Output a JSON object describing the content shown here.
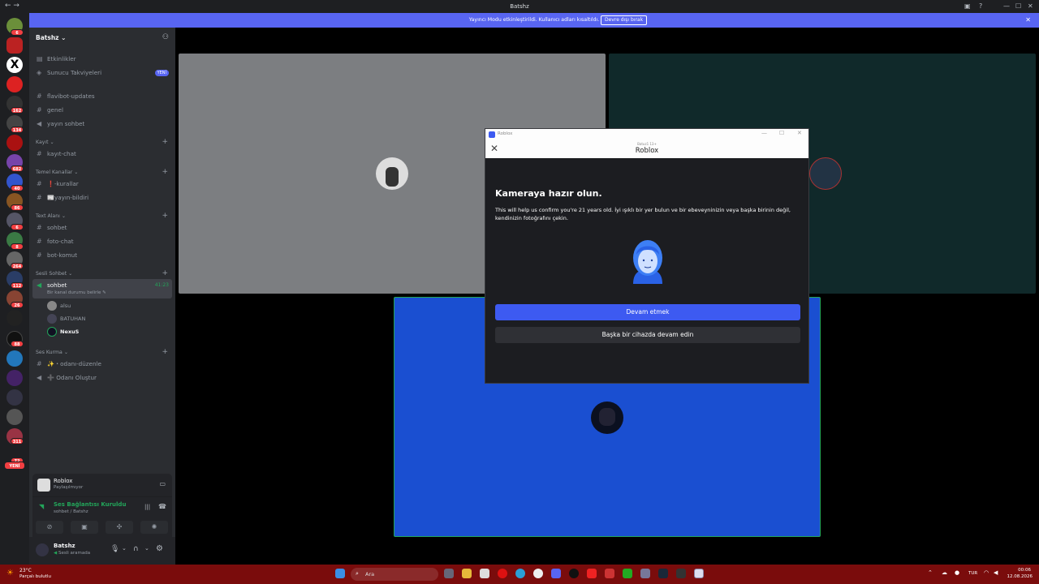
{
  "window": {
    "title": "Batshz",
    "back": "←",
    "forward": "→"
  },
  "banner": {
    "text": "Yayıncı Modu etkinleştirildi. Kullanıcı adları kısaltıldı.",
    "button": "Devre dışı bırak"
  },
  "rail": {
    "badges": [
      "6",
      "162",
      "134",
      "682",
      "40",
      "86",
      "6",
      "8",
      "264",
      "112",
      "26",
      "88",
      "311",
      "72"
    ],
    "new_label": "YENİ"
  },
  "server": {
    "name": "Batshz",
    "top_items": [
      {
        "label": "Etkinlikler",
        "icon": "calendar-icon"
      },
      {
        "label": "Sunucu Takviyeleri",
        "icon": "boost-icon",
        "badge": "YENİ"
      }
    ],
    "channels": [
      "flavibot-updates",
      "genel",
      "yayın sohbet"
    ],
    "categories": [
      {
        "name": "Kayıt",
        "channels": [
          "kayıt-chat"
        ]
      },
      {
        "name": "Temel Kanallar",
        "channels": [
          "❗-kurallar",
          "📰yayın-bildiri"
        ]
      },
      {
        "name": "Text Alanı",
        "channels": [
          "sohbet",
          "foto-chat",
          "bot-komut"
        ]
      },
      {
        "name": "Sesli Sohbet",
        "voice": {
          "name": "sohbet",
          "time": "41:23",
          "status_prompt": "Bir kanal durumu belirle",
          "users": [
            "alsu",
            "BATUHAN",
            "NexuS"
          ]
        }
      },
      {
        "name": "Ses Kurma",
        "channels": [
          "✨・odanı-düzenle",
          "➕ Odanı Oluştur"
        ]
      }
    ]
  },
  "activity": {
    "name": "Roblox",
    "sub": "Paylaşılmıyor"
  },
  "voice_panel": {
    "status": "Ses Bağlantısı Kuruldu",
    "location": "sohbet / Batshz"
  },
  "user": {
    "name": "Batshz",
    "status": "Sesli aramada"
  },
  "dialog": {
    "window_title": "Roblox",
    "small_title": "Batuz1 13+",
    "header": "Roblox",
    "heading": "Kameraya hazır olun.",
    "body": "This will help us confirm you're 21 years old. İyi ışıklı bir yer bulun ve bir ebeveyninizin veya başka birinin değil, kendinizin fotoğrafını çekin.",
    "primary_button": "Devam etmek",
    "secondary_button": "Başka bir cihazda devam edin"
  },
  "taskbar": {
    "weather_temp": "23°C",
    "weather_desc": "Parçalı bulutlu",
    "search_placeholder": "Ara",
    "lang": "TUR",
    "time": "00:06",
    "date": "12.08.2026"
  },
  "colors": {
    "accent": "#5865f2",
    "green": "#23a55a",
    "dialog_blue": "#3d5af1",
    "tile_blue": "#1a4fd1"
  }
}
